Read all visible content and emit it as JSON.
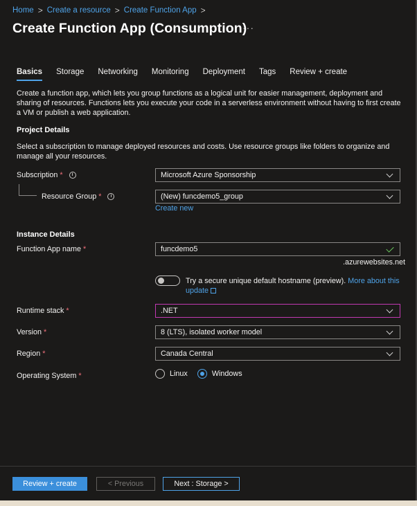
{
  "breadcrumb": {
    "items": [
      "Home",
      "Create a resource",
      "Create Function App"
    ],
    "sep": ">"
  },
  "page": {
    "title": "Create Function App (Consumption)",
    "more": "···"
  },
  "tabs": [
    "Basics",
    "Storage",
    "Networking",
    "Monitoring",
    "Deployment",
    "Tags",
    "Review + create"
  ],
  "intro": "Create a function app, which lets you group functions as a logical unit for easier management, deployment and sharing of resources. Functions lets you execute your code in a serverless environment without having to first create a VM or publish a web application.",
  "project": {
    "title": "Project Details",
    "desc": "Select a subscription to manage deployed resources and costs. Use resource groups like folders to organize and manage all your resources.",
    "subscription_label": "Subscription",
    "subscription_value": "Microsoft Azure Sponsorship",
    "resource_group_label": "Resource Group",
    "resource_group_value": "(New) funcdemo5_group",
    "create_new": "Create new"
  },
  "instance": {
    "title": "Instance Details",
    "app_name_label": "Function App name",
    "app_name_value": "funcdemo5",
    "domain_suffix": ".azurewebsites.net",
    "toggle_text": "Try a secure unique default hostname (preview).",
    "toggle_link": "More about this update",
    "runtime_label": "Runtime stack",
    "runtime_value": ".NET",
    "version_label": "Version",
    "version_value": "8 (LTS), isolated worker model",
    "region_label": "Region",
    "region_value": "Canada Central",
    "os_label": "Operating System",
    "os_options": [
      "Linux",
      "Windows"
    ],
    "os_selected": "Windows"
  },
  "required_mark": "*",
  "info_glyph": "i",
  "footer": {
    "review": "Review + create",
    "previous": "< Previous",
    "next": "Next : Storage >"
  },
  "colors": {
    "accent": "#4fa3e8",
    "required": "#f1707b",
    "focus": "#c239b3",
    "valid": "#6ccb5f",
    "background": "#1b1a19"
  }
}
